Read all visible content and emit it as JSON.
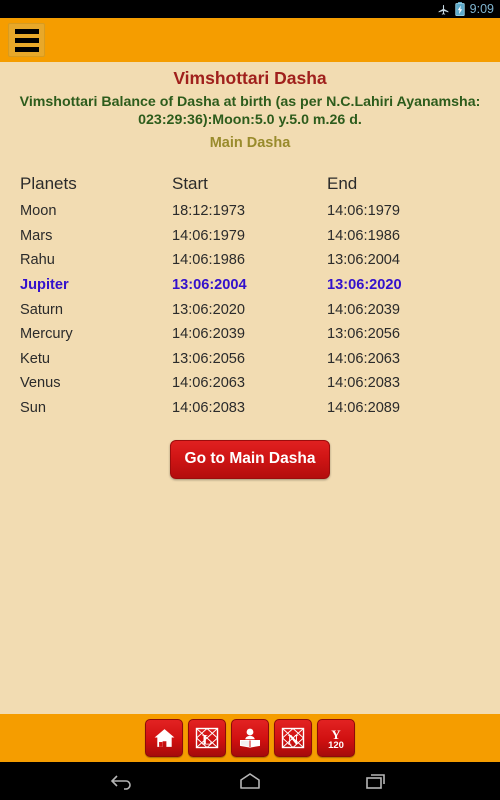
{
  "status_bar": {
    "airplane_icon": "airplane-mode-icon",
    "battery_icon": "battery-charging-icon",
    "clock": "9:09",
    "clock_color": "#7fb5d0"
  },
  "app_bar": {
    "menu_icon": "hamburger-menu-icon",
    "background_color": "#f59d00"
  },
  "content": {
    "background_color": "#f2dcb2",
    "title": "Vimshottari Dasha",
    "title_color": "#a0201c",
    "balance_text": "Vimshottari Balance of Dasha at birth (as per N.C.Lahiri Ayanamsha: 023:29:36):Moon:5.0 y.5.0 m.26 d.",
    "balance_color": "#2d5c1c",
    "subtitle": "Main Dasha",
    "subtitle_color": "#998b2c"
  },
  "table": {
    "headers": [
      "Planets",
      "Start",
      "End"
    ],
    "highlight_color": "#3311cc",
    "rows": [
      {
        "planet": "Moon",
        "start": "18:12:1973",
        "end": "14:06:1979",
        "highlight": false
      },
      {
        "planet": "Mars",
        "start": "14:06:1979",
        "end": "14:06:1986",
        "highlight": false
      },
      {
        "planet": "Rahu",
        "start": "14:06:1986",
        "end": "13:06:2004",
        "highlight": false
      },
      {
        "planet": "Jupiter",
        "start": "13:06:2004",
        "end": "13:06:2020",
        "highlight": true
      },
      {
        "planet": "Saturn",
        "start": "13:06:2020",
        "end": "14:06:2039",
        "highlight": false
      },
      {
        "planet": "Mercury",
        "start": "14:06:2039",
        "end": "13:06:2056",
        "highlight": false
      },
      {
        "planet": "Ketu",
        "start": "13:06:2056",
        "end": "14:06:2063",
        "highlight": false
      },
      {
        "planet": "Venus",
        "start": "14:06:2063",
        "end": "14:06:2083",
        "highlight": false
      },
      {
        "planet": "Sun",
        "start": "14:06:2083",
        "end": "14:06:2089",
        "highlight": false
      }
    ]
  },
  "action": {
    "goto_main_dasha_label": "Go to Main Dasha",
    "button_color": "#d01515"
  },
  "bottom_toolbar": {
    "background_color": "#f59d00",
    "buttons": [
      {
        "name": "home-icon",
        "glyph": ""
      },
      {
        "name": "lagna-chart-icon",
        "glyph": "L"
      },
      {
        "name": "reading-person-icon",
        "glyph": ""
      },
      {
        "name": "navamsa-chart-icon",
        "glyph": "N"
      },
      {
        "name": "yoga-120-icon",
        "glyph": "Y",
        "sub": "120"
      }
    ]
  },
  "nav_bar": {
    "back_icon": "back-arrow-icon",
    "home_icon": "home-pentagon-icon",
    "recents_icon": "recent-apps-icon"
  }
}
